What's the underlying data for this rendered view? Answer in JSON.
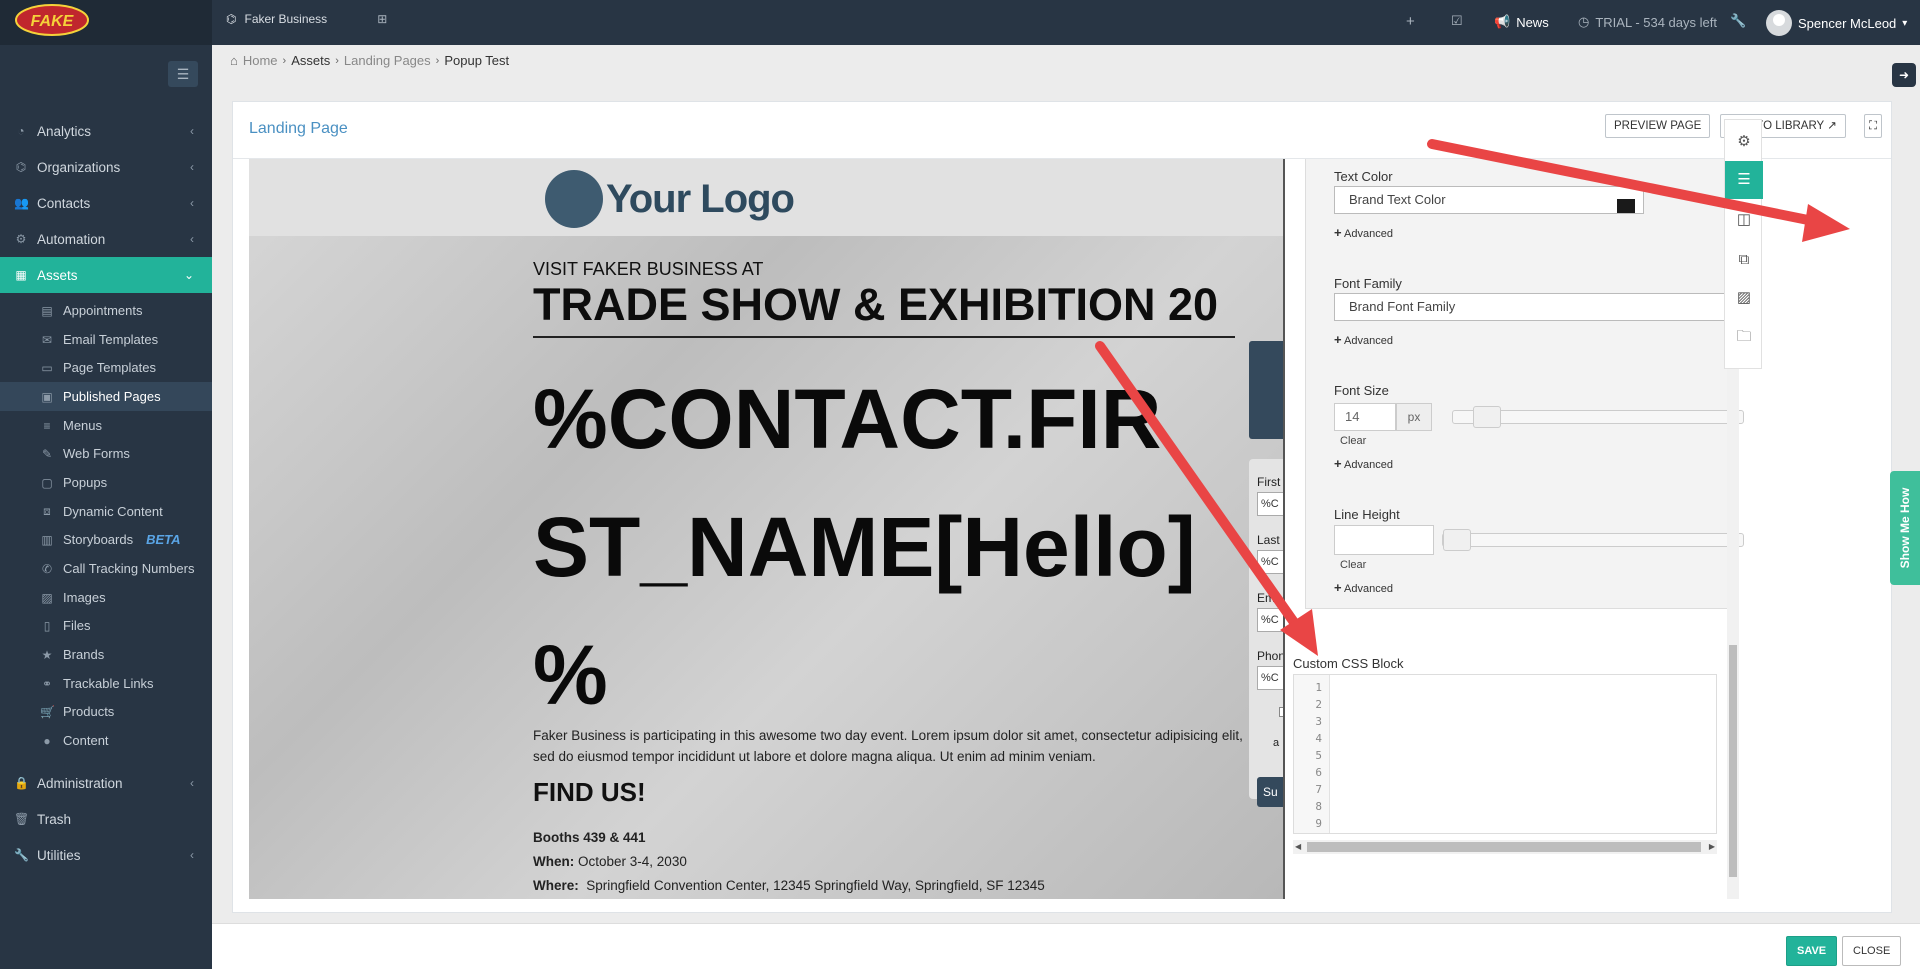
{
  "topbar": {
    "logo_text": "FAKE",
    "org_name": "Faker Business",
    "news": "News",
    "trial": "TRIAL - 534 days left",
    "user": "Spencer McLeod"
  },
  "sidebar": {
    "main_items": [
      {
        "label": "Analytics",
        "icon": "dashboard-icon"
      },
      {
        "label": "Organizations",
        "icon": "sitemap-icon"
      },
      {
        "label": "Contacts",
        "icon": "users-icon"
      },
      {
        "label": "Automation",
        "icon": "cogs-icon"
      },
      {
        "label": "Assets",
        "icon": "grid-icon"
      }
    ],
    "sub_items": [
      "Appointments",
      "Email Templates",
      "Page Templates",
      "Published Pages",
      "Menus",
      "Web Forms",
      "Popups",
      "Dynamic Content",
      "Storyboards",
      "Call Tracking Numbers",
      "Images",
      "Files",
      "Brands",
      "Trackable Links",
      "Products",
      "Content"
    ],
    "beta": "BETA",
    "bottom_items": [
      {
        "label": "Administration"
      },
      {
        "label": "Trash"
      },
      {
        "label": "Utilities"
      }
    ]
  },
  "breadcrumb": {
    "home": "Home",
    "assets": "Assets",
    "landing": "Landing Pages",
    "current": "Popup Test"
  },
  "panel": {
    "title": "Landing Page",
    "preview_btn": "PREVIEW PAGE",
    "library_btn": "ADD TO LIBRARY"
  },
  "canvas": {
    "logo": "Your Logo",
    "visit": "VISIT FAKER BUSINESS AT",
    "trade": "TRADE SHOW & EXHIBITION 20",
    "bigname_1": "%CONTACT.FIR",
    "bigname_2": "ST_NAME[Hello]",
    "bigname_3": "%",
    "desc": "Faker Business is participating in this awesome two day event. Lorem ipsum dolor sit amet, consectetur adipisicing elit, sed do eiusmod tempor incididunt ut labore et dolore magna aliqua. Ut enim ad minim veniam.",
    "find": "FIND US!",
    "booths": "Booths 439 & 441",
    "when_label": "When:",
    "when": "October 3-4, 2030",
    "where_label": "Where:",
    "where": "Springfield Convention Center,  12345 Springfield Way,  Springfield, SF 12345",
    "form": {
      "first": "First",
      "last": "Last",
      "email": "Em",
      "phone": "Phon",
      "value": "%C",
      "consent": "a",
      "submit": "Su"
    }
  },
  "settings": {
    "text_color_label": "Text Color",
    "text_color_value": "Brand Text Color",
    "advanced": "Advanced",
    "font_family_label": "Font Family",
    "font_family_value": "Brand Font Family",
    "font_size_label": "Font Size",
    "font_size_value": "14",
    "font_size_unit": "px",
    "clear": "Clear",
    "line_height_label": "Line Height",
    "css_block_label": "Custom CSS Block",
    "line_numbers": [
      "1",
      "2",
      "3",
      "4",
      "5",
      "6",
      "7",
      "8",
      "9"
    ]
  },
  "showme": "Show Me How",
  "footer": {
    "save": "SAVE",
    "close": "CLOSE"
  },
  "colors": {
    "accent": "#22b39a",
    "nav": "#283544",
    "arrow": "#e94545"
  }
}
